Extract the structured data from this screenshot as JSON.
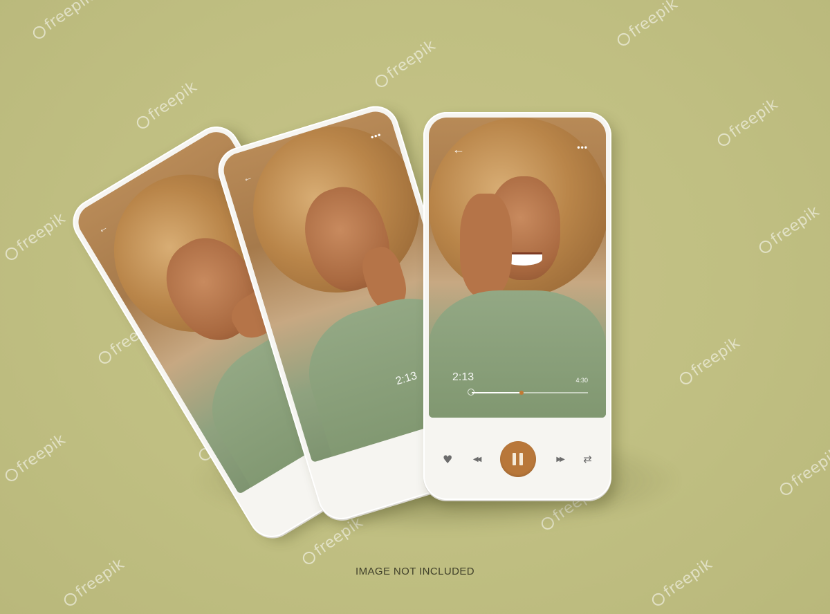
{
  "colors": {
    "background": "#c3c185",
    "phone_body": "#f6f5f1",
    "accent": "#b8773a",
    "control_icons": "#6c6c6c"
  },
  "watermark": {
    "text": "freepik",
    "icon": "freepik-logo-icon"
  },
  "phones": {
    "back": {
      "icons": {
        "back": "back-arrow-icon"
      }
    },
    "middle": {
      "icons": {
        "back": "back-arrow-icon",
        "more": "more-dots-icon"
      },
      "elapsed_time": "2:13"
    },
    "front": {
      "icons": {
        "back": "back-arrow-icon",
        "more": "more-dots-icon"
      },
      "back_glyph": "←",
      "more_glyph": "•••",
      "elapsed_time": "2:13",
      "total_time": "4:30",
      "progress_fraction": 0.43,
      "controls": {
        "like_icon": "heart-icon",
        "like_glyph": "♥",
        "prev_icon": "rewind-icon",
        "prev_glyph": "◀◀",
        "play_icon": "pause-icon",
        "next_icon": "fast-forward-icon",
        "next_glyph": "▶▶",
        "repeat_icon": "repeat-icon",
        "repeat_glyph": "⇄"
      }
    }
  },
  "caption": "IMAGE NOT INCLUDED"
}
